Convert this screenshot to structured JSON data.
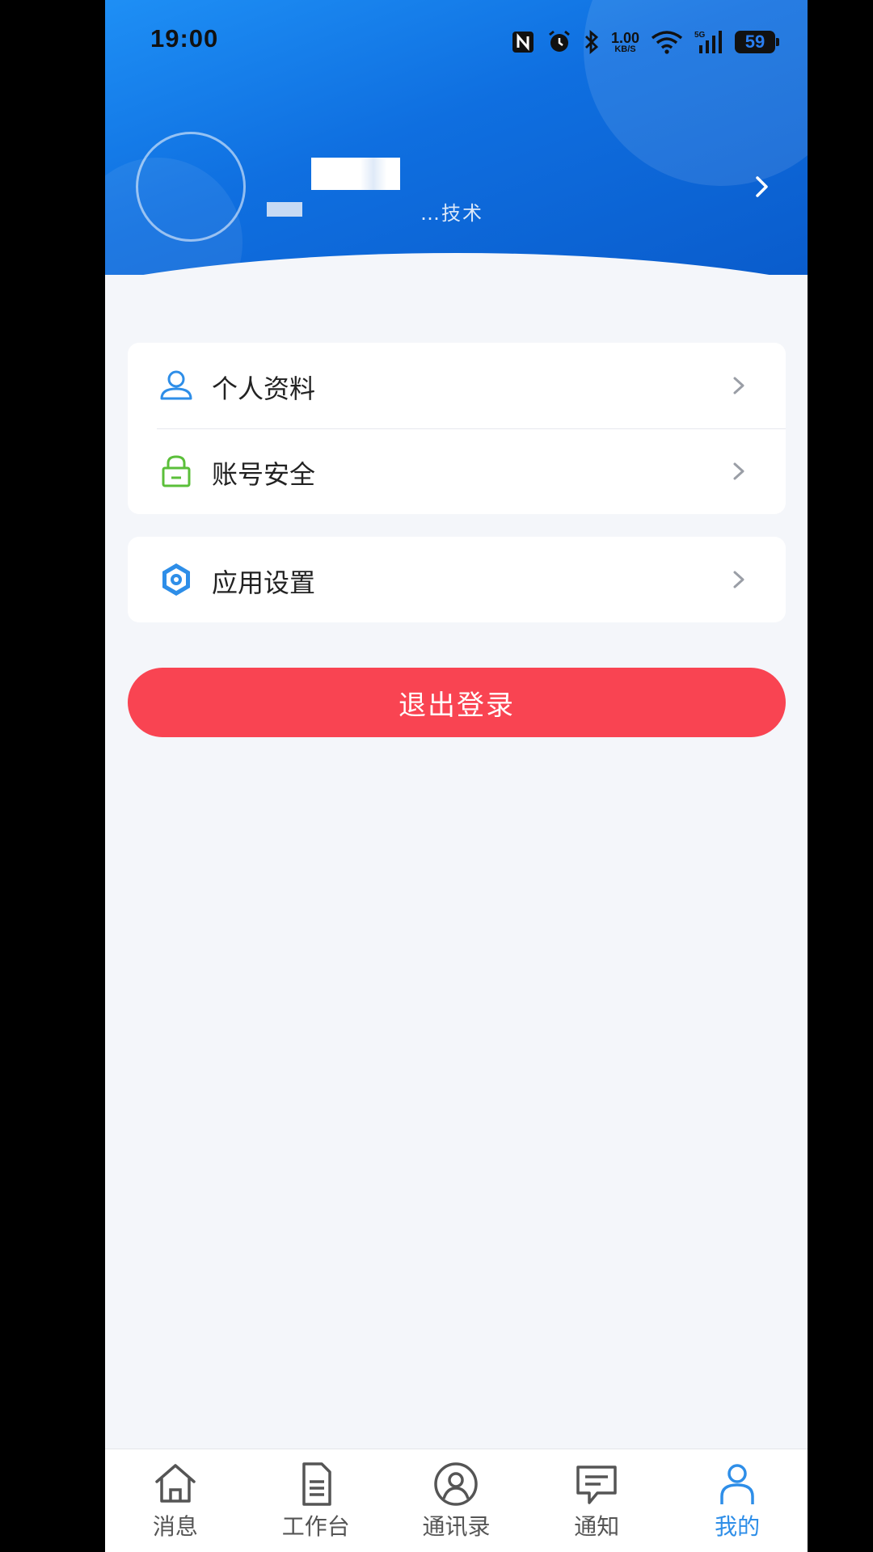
{
  "status_bar": {
    "time": "19:00",
    "net_speed_value": "1.00",
    "net_speed_unit": "KB/S",
    "battery_level": "59",
    "icons": [
      "nfc-icon",
      "alarm-icon",
      "bluetooth-icon",
      "wifi-icon",
      "5g-signal-icon",
      "battery-icon"
    ]
  },
  "profile": {
    "name": "",
    "department": "…技术部"
  },
  "menu": {
    "group1": [
      {
        "label": "个人资料",
        "icon": "person-icon"
      },
      {
        "label": "账号安全",
        "icon": "lock-icon"
      }
    ],
    "group2": [
      {
        "label": "应用设置",
        "icon": "settings-icon"
      }
    ]
  },
  "logout_label": "退出登录",
  "tabbar": {
    "items": [
      {
        "label": "消息",
        "icon": "home-icon"
      },
      {
        "label": "工作台",
        "icon": "document-icon"
      },
      {
        "label": "通讯录",
        "icon": "contacts-icon"
      },
      {
        "label": "通知",
        "icon": "message-icon"
      },
      {
        "label": "我的",
        "icon": "user-icon",
        "active": true
      }
    ]
  },
  "colors": {
    "header_blue": "#1e8ff5",
    "logout_red": "#f94452",
    "active_tab": "#2e8ee8",
    "lock_green": "#5bbf3a"
  }
}
